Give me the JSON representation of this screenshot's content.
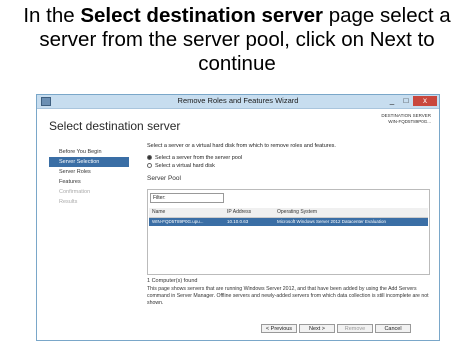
{
  "slide": {
    "line1_prefix": "In the ",
    "line1_bold": "Select destination server",
    "line1_suffix": " page select a",
    "line2": "server from the server pool, click on Next to",
    "line3": "continue"
  },
  "window": {
    "title": "Remove Roles and Features Wizard",
    "controls": {
      "min": "_",
      "max": "□",
      "close": "x"
    },
    "page_title": "Select destination server",
    "destination_label": "DESTINATION SERVER",
    "destination_value": "WIN-FQD5T89P0G..."
  },
  "nav": {
    "items": [
      {
        "label": "Before You Begin"
      },
      {
        "label": "Server Selection"
      },
      {
        "label": "Server Roles"
      },
      {
        "label": "Features"
      },
      {
        "label": "Confirmation"
      },
      {
        "label": "Results"
      }
    ]
  },
  "content": {
    "instruction": "Select a server or a virtual hard disk from which to remove roles and features.",
    "radio_server": "Select a server from the server pool",
    "radio_vhd": "Select a virtual hard disk",
    "server_pool_heading": "Server Pool",
    "filter_label": "Filter:",
    "columns": [
      "Name",
      "IP Address",
      "Operating System"
    ],
    "rows": [
      {
        "name": "WIN-FQD5T89P0G.upu...",
        "ip": "10.10.0.63",
        "os": "Microsoft Windows Server 2012 Datacenter Evaluation"
      }
    ],
    "found": "1 Computer(s) found",
    "note": "This page shows servers that are running Windows Server 2012, and that have been added by using the Add Servers command in Server Manager. Offline servers and newly-added servers from which data collection is still incomplete are not shown."
  },
  "buttons": {
    "previous": "< Previous",
    "next": "Next >",
    "remove": "Remove",
    "cancel": "Cancel"
  }
}
